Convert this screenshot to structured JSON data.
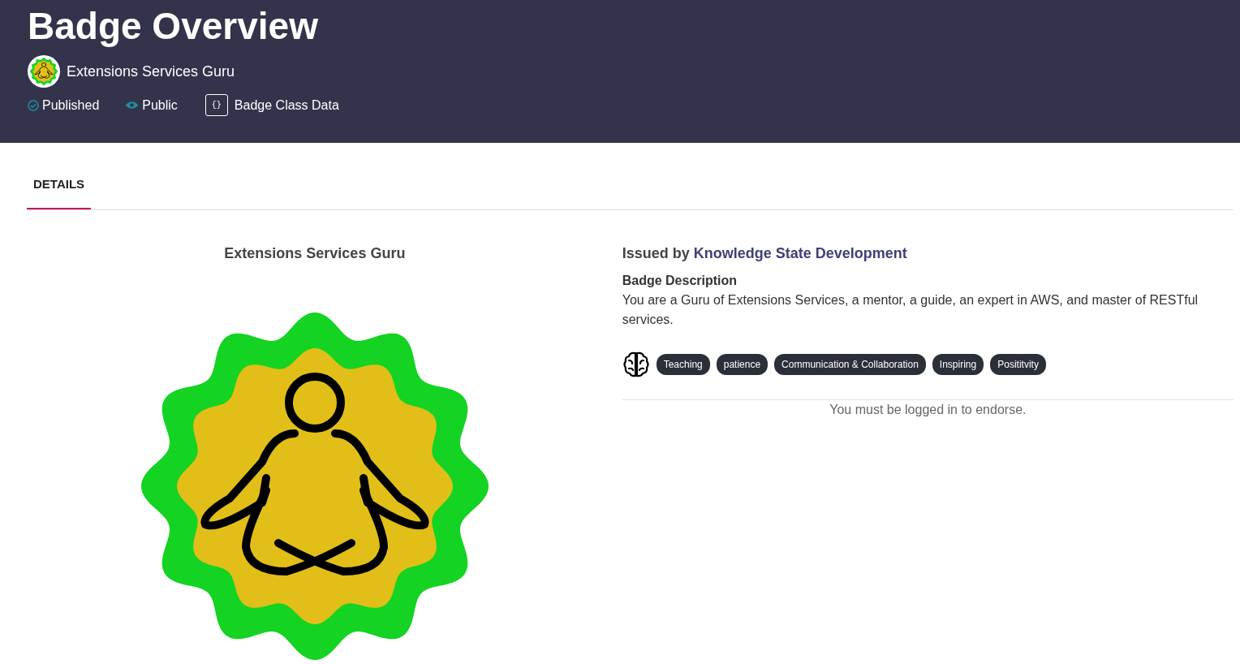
{
  "header": {
    "title": "Badge Overview",
    "badge_name": "Extensions Services Guru",
    "statuses": [
      {
        "kind": "published",
        "label": "Published"
      },
      {
        "kind": "visibility",
        "label": "Public"
      },
      {
        "kind": "data",
        "icon_text": "{}",
        "label": "Badge Class Data"
      }
    ]
  },
  "tabs": [
    {
      "label": "DETAILS",
      "selected": true
    }
  ],
  "details": {
    "badge_title": "Extensions Services Guru",
    "issued_prefix": "Issued by",
    "issuer": "Knowledge State Development",
    "description_heading": "Badge Description",
    "description": "You are a Guru of Extensions Services, a mentor, a guide, an expert in AWS, and master of RESTful services.",
    "tags": [
      "Teaching",
      "patience",
      "Communication & Collaboration",
      "Inspiring",
      "Posititvity"
    ],
    "endorse_note": "You must be logged in to endorse."
  }
}
